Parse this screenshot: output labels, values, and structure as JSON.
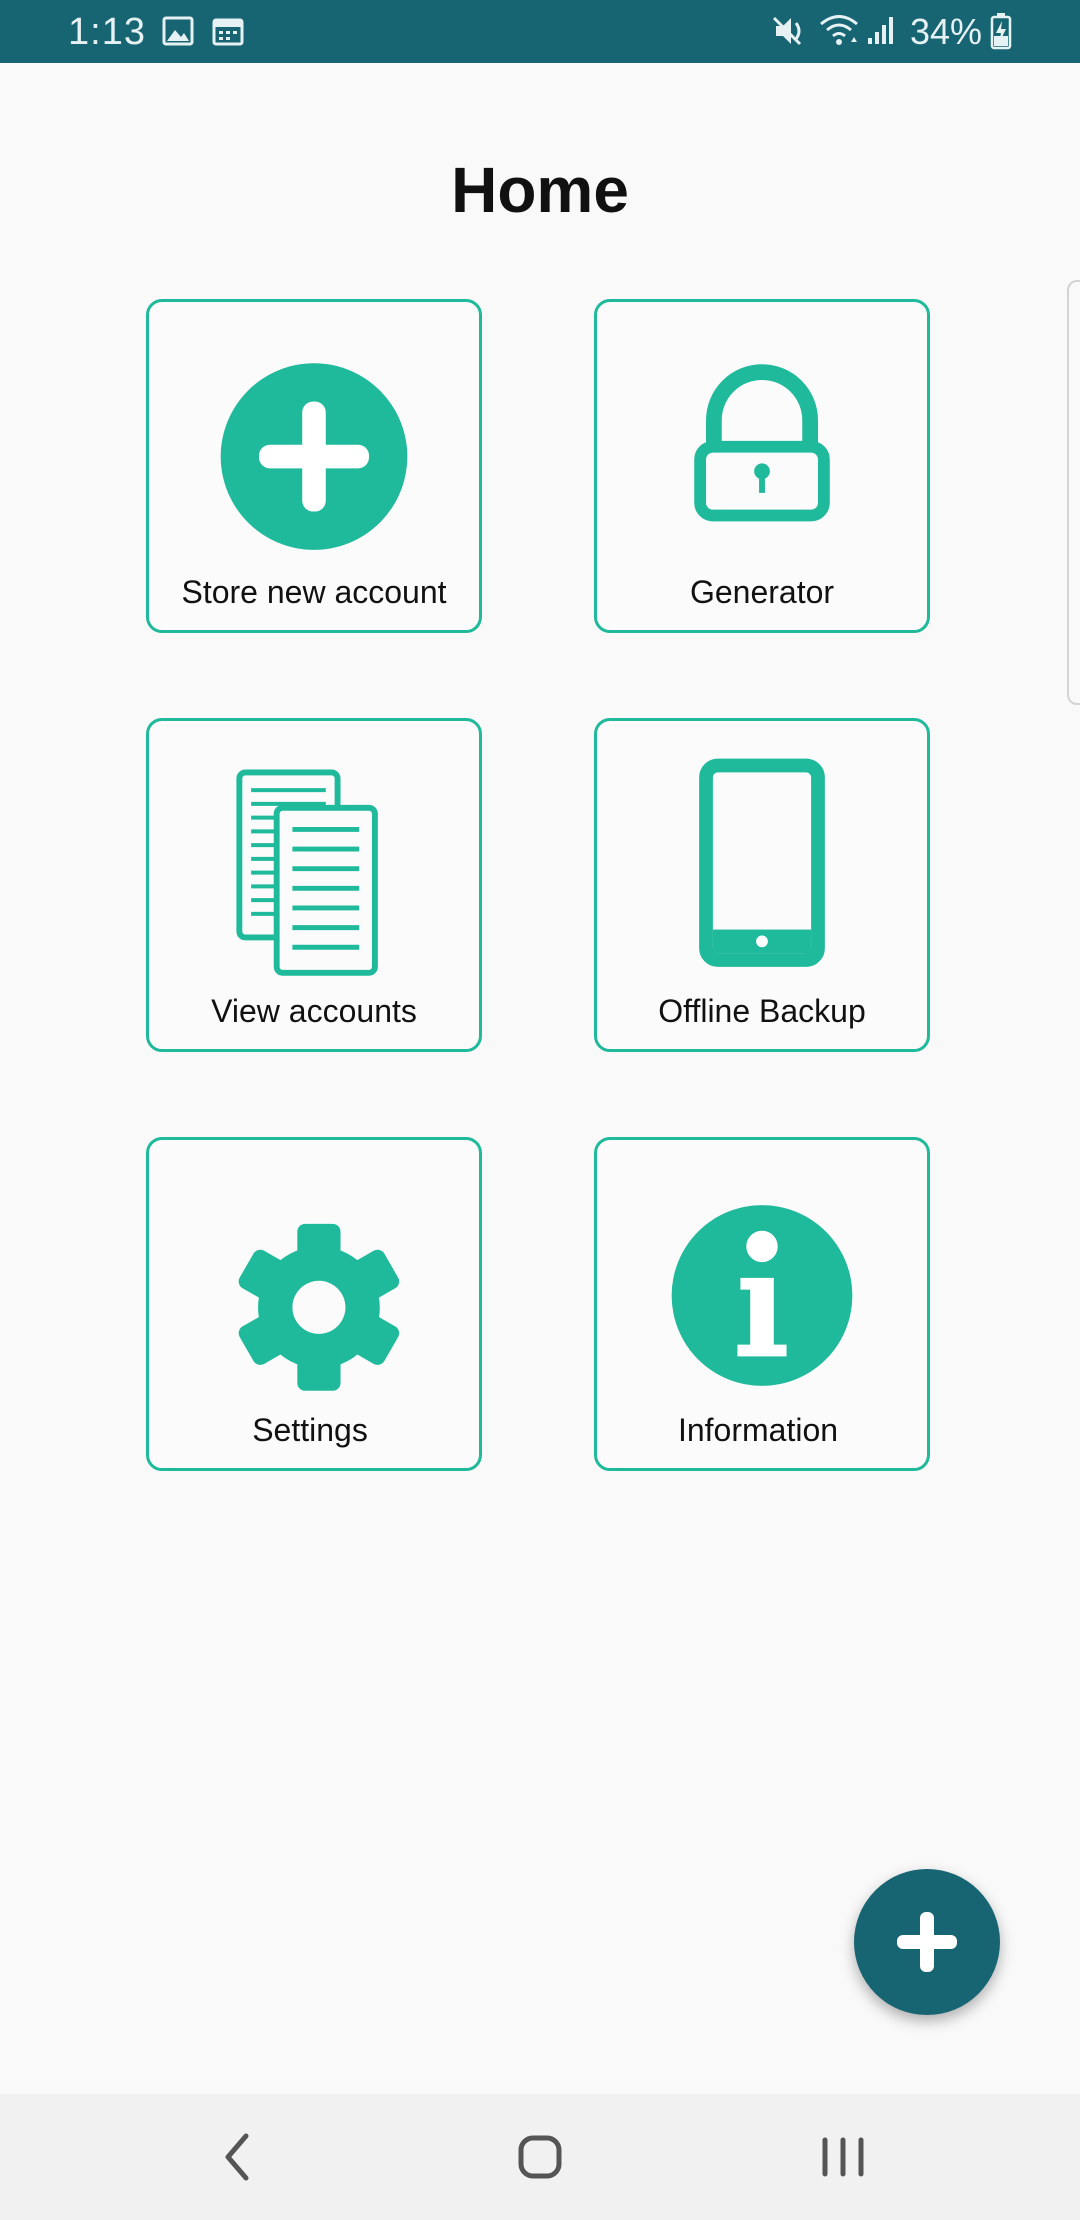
{
  "status_bar": {
    "time": "1:13",
    "battery_percent": "34%",
    "icons": [
      "image-icon",
      "calendar-icon",
      "mute-icon",
      "wifi-icon",
      "signal-icon",
      "battery-charging-icon"
    ],
    "background": "#176472"
  },
  "page": {
    "title": "Home"
  },
  "tiles": [
    {
      "label": "Store new account",
      "icon": "plus-circle-icon"
    },
    {
      "label": "Generator",
      "icon": "lock-icon"
    },
    {
      "label": "View accounts",
      "icon": "documents-icon"
    },
    {
      "label": "Offline Backup",
      "icon": "phone-icon"
    },
    {
      "label": "Settings",
      "icon": "gear-icon"
    },
    {
      "label": "Information",
      "icon": "info-icon"
    }
  ],
  "fab": {
    "icon": "plus-icon",
    "color": "#176472"
  },
  "nav_bar": {
    "buttons": [
      "back-icon",
      "home-icon",
      "recents-icon"
    ]
  },
  "colors": {
    "accent": "#1fb99b",
    "primary_dark": "#176472"
  }
}
